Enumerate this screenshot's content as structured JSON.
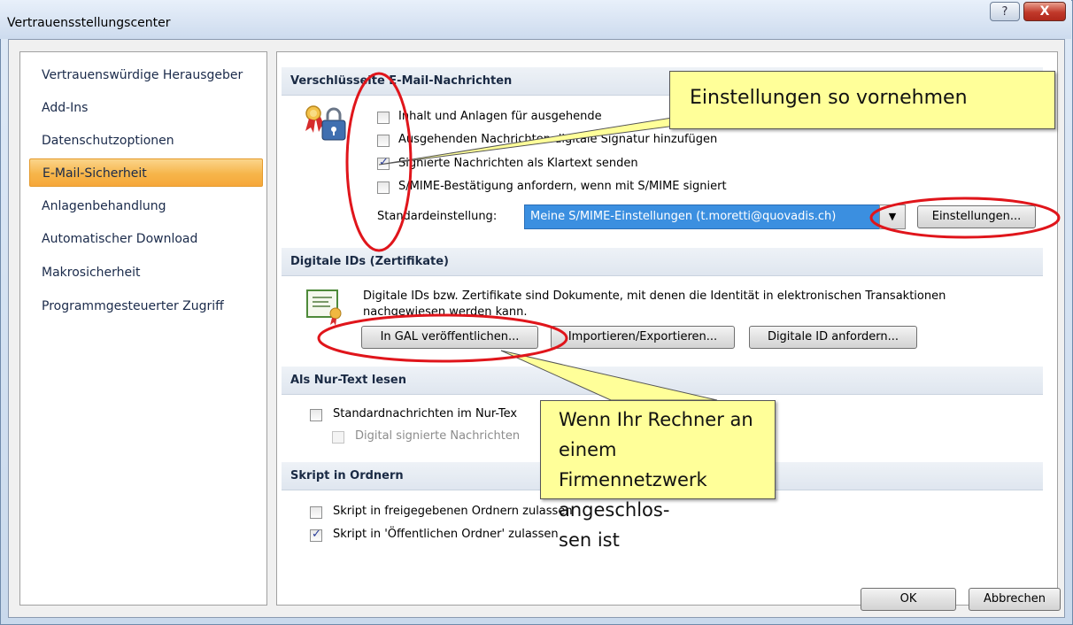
{
  "window": {
    "title": "Vertrauensstellungscenter",
    "help_label": "?",
    "close_label": "X"
  },
  "nav": {
    "items": [
      "Vertrauenswürdige Herausgeber",
      "Add-Ins",
      "Datenschutzoptionen",
      "E-Mail-Sicherheit",
      "Anlagenbehandlung",
      "Automatischer Download",
      "Makrosicherheit",
      "Programmgesteuerter Zugriff"
    ],
    "selected_index": 3
  },
  "sections": {
    "encrypted": {
      "title": "Verschlüsselte E-Mail-Nachrichten",
      "options": [
        {
          "label": "Inhalt und Anlagen für ausgehende",
          "checked": false
        },
        {
          "label": "Ausgehenden Nachrichten digitale Signatur hinzufügen",
          "checked": false
        },
        {
          "label": "Signierte Nachrichten als Klartext senden",
          "checked": true
        },
        {
          "label": "S/MIME-Bestätigung anfordern, wenn mit S/MIME signiert",
          "checked": false
        }
      ],
      "default_label": "Standardeinstellung:",
      "default_value": "Meine S/MIME-Einstellungen (t.moretti@quovadis.ch)",
      "settings_button": "Einstellungen..."
    },
    "digital_ids": {
      "title": "Digitale IDs (Zertifikate)",
      "description_line1": "Digitale IDs bzw. Zertifikate sind Dokumente, mit denen die Identität in elektronischen Transaktionen",
      "description_line2": "nachgewiesen werden kann.",
      "buttons": [
        "In GAL veröffentlichen...",
        "Importieren/Exportieren...",
        "Digitale ID anfordern..."
      ]
    },
    "plain_text": {
      "title": "Als Nur-Text lesen",
      "options": [
        {
          "label": "Standardnachrichten im Nur-Tex",
          "checked": false,
          "disabled": false
        },
        {
          "label": "Digital signierte Nachrichten",
          "checked": false,
          "disabled": true
        }
      ]
    },
    "script": {
      "title": "Skript in Ordnern",
      "options": [
        {
          "label": "Skript in freigegebenen Ordnern zulassen",
          "checked": false
        },
        {
          "label": "Skript in 'Öffentlichen Ordner' zulassen",
          "checked": true
        }
      ]
    }
  },
  "footer": {
    "ok": "OK",
    "cancel": "Abbrechen"
  },
  "annotations": {
    "callout_top": "Einstellungen so vornehmen",
    "callout_bottom_lines": [
      "Wenn Ihr Rechner an einem",
      "Firmennetzwerk angeschlos-",
      "sen ist"
    ]
  },
  "colors": {
    "annotation_ring": "#e0151b",
    "callout_fill": "#ffff99",
    "selected_nav": "#f6b54a",
    "dropdown_selection": "#3b8fe0"
  }
}
